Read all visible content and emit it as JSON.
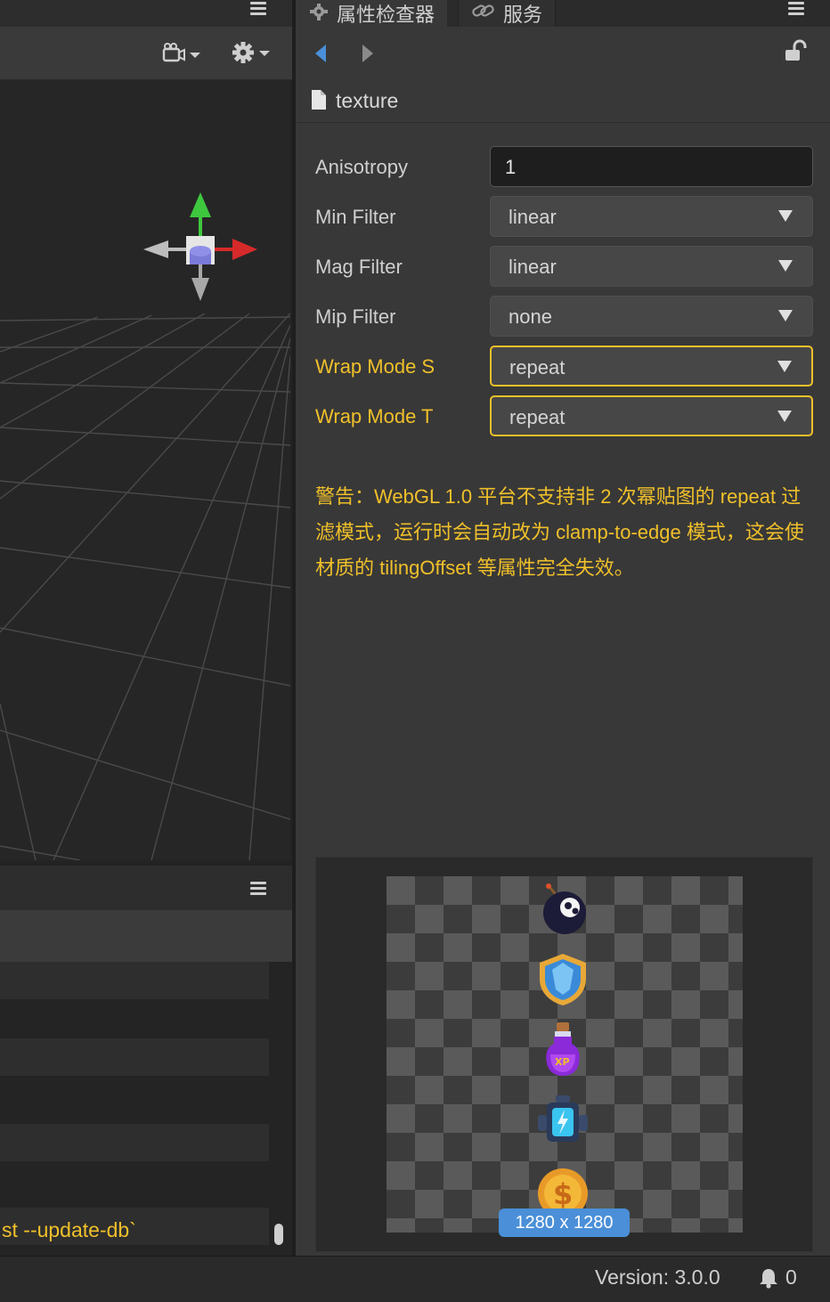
{
  "left_panel": {
    "console_text": "st --update-db`"
  },
  "inspector": {
    "tabs": [
      {
        "label": "属性检查器",
        "icon": "gear-icon"
      },
      {
        "label": "服务",
        "icon": "link-icon"
      }
    ],
    "asset_name": "texture",
    "properties": [
      {
        "label": "Anisotropy",
        "value": "1",
        "kind": "input"
      },
      {
        "label": "Min Filter",
        "value": "linear",
        "kind": "select"
      },
      {
        "label": "Mag Filter",
        "value": "linear",
        "kind": "select"
      },
      {
        "label": "Mip Filter",
        "value": "none",
        "kind": "select"
      },
      {
        "label": "Wrap Mode S",
        "value": "repeat",
        "kind": "select",
        "warning": true
      },
      {
        "label": "Wrap Mode T",
        "value": "repeat",
        "kind": "select",
        "warning": true
      }
    ],
    "warning_message": "警告：WebGL 1.0 平台不支持非 2 次幂贴图的 repeat 过滤模式，运行时会自动改为 clamp-to-edge 模式，这会使材质的 tilingOffset 等属性完全失效。",
    "preview": {
      "size_label": "1280 x 1280",
      "sprites": [
        "bomb-icon",
        "shield-icon",
        "xp-potion-icon",
        "battery-icon",
        "coin-icon"
      ]
    }
  },
  "statusbar": {
    "version": "Version: 3.0.0",
    "notification_count": "0"
  },
  "colors": {
    "warning": "#f0c02a",
    "accent_blue": "#4a8fd8",
    "panel_bg": "#383838"
  }
}
